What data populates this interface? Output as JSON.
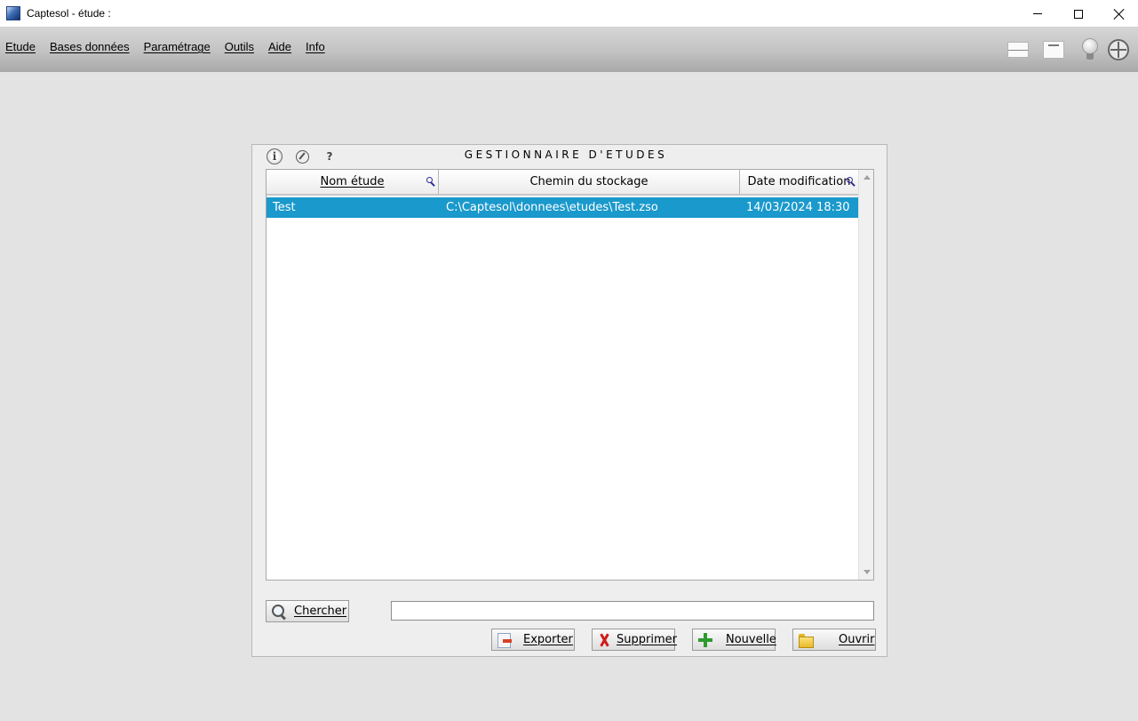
{
  "window": {
    "title": "Captesol - étude :",
    "icon": "app-icon",
    "controls": [
      "minimize-icon",
      "maximize-icon",
      "close-icon"
    ]
  },
  "menu": {
    "items": [
      {
        "label": "Etude"
      },
      {
        "label": "Bases données"
      },
      {
        "label": "Paramétrage"
      },
      {
        "label": "Outils"
      },
      {
        "label": "Aide"
      },
      {
        "label": "Info"
      }
    ],
    "toolbar_icons": [
      "window-icon",
      "window-list-icon",
      "lightbulb-icon",
      "compass-icon"
    ]
  },
  "panel": {
    "title": "GESTIONNAIRE D'ETUDES",
    "icons": [
      "info-icon",
      "navigation-icon",
      "help-icon"
    ],
    "help_glyph": "?",
    "info_glyph": "i",
    "table": {
      "columns": [
        "Nom étude",
        "Chemin du stockage",
        "Date modification"
      ],
      "rows": [
        {
          "name": "Test",
          "path": "C:\\Captesol\\donnees\\etudes\\Test.zso",
          "date": "14/03/2024 18:30",
          "selected": true
        }
      ]
    },
    "search": {
      "button_label": "Chercher",
      "value": ""
    },
    "actions": {
      "export_label": "Exporter",
      "delete_label": "Supprimer",
      "new_label": "Nouvelle",
      "open_label": "Ouvrir"
    }
  },
  "colors": {
    "selection": "#1a99cc",
    "background": "#e3e3e3",
    "panel": "#eeeeee",
    "sort_key": "#2b2f9a"
  }
}
